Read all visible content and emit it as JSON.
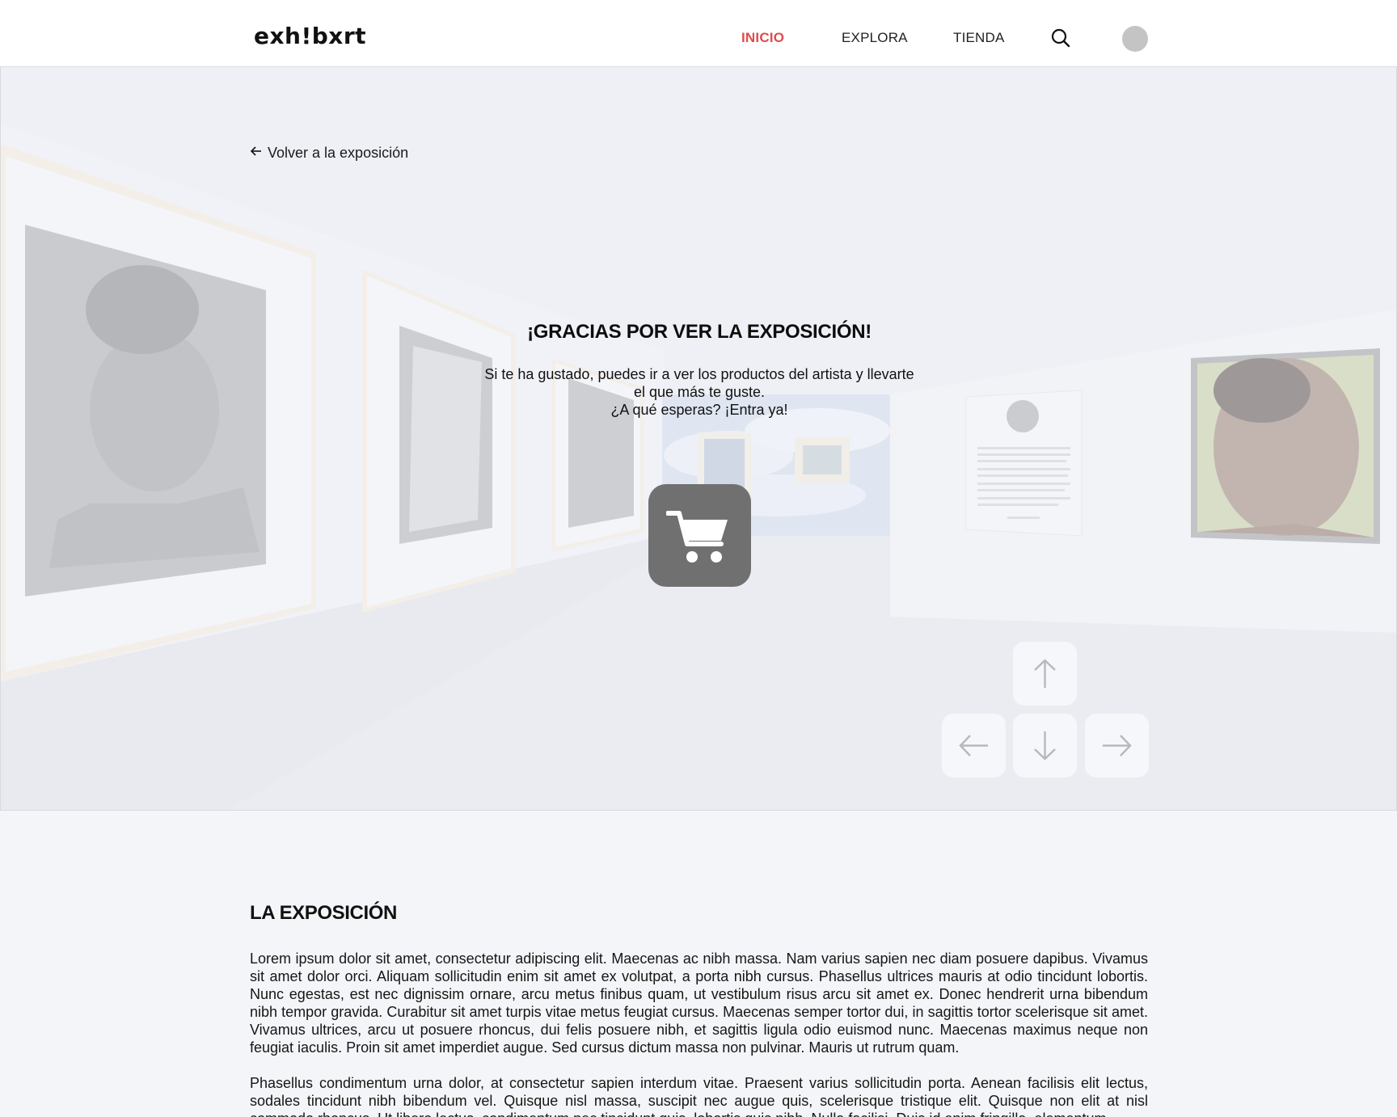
{
  "header": {
    "logo": "exh!bxrt",
    "nav": [
      {
        "label": "INICIO",
        "active": true
      },
      {
        "label": "EXPLORA",
        "active": false
      },
      {
        "label": "TIENDA",
        "active": false
      }
    ],
    "icons": {
      "search": "search-icon",
      "avatar": "avatar"
    }
  },
  "hero": {
    "back_label": "Volver a la exposición",
    "title": "¡GRACIAS POR VER LA EXPOSICIÓN!",
    "message_lines": [
      "Si te ha gustado, puedes ir a ver los productos del artista y llevarte",
      "el que más te guste.",
      "¿A qué esperas? ¡Entra ya!"
    ],
    "cart_icon": "cart-icon",
    "controls": [
      "arrow-up-icon",
      "arrow-left-icon",
      "arrow-down-icon",
      "arrow-right-icon"
    ]
  },
  "content": {
    "section_title": "LA EXPOSICIÓN",
    "paragraphs": [
      "Lorem ipsum dolor sit amet, consectetur adipiscing elit. Maecenas ac nibh massa. Nam varius sapien nec diam posuere dapibus. Vivamus sit amet dolor orci. Aliquam sollicitudin enim sit amet ex volutpat, a porta nibh cursus. Phasellus ultrices mauris at odio tincidunt lobortis. Nunc egestas, est nec dignissim ornare, arcu metus finibus quam, ut vestibulum risus arcu sit amet ex. Donec hendrerit urna bibendum nibh tempor gravida. Curabitur sit amet turpis vitae metus feugiat cursus. Maecenas semper tortor dui, in sagittis tortor scelerisque sit amet. Vivamus ultrices, arcu ut posuere rhoncus, dui felis posuere nibh, et sagittis ligula odio euismod nunc. Maecenas maximus neque non feugiat iaculis. Proin sit amet imperdiet augue. Sed cursus dictum massa non pulvinar. Mauris ut rutrum quam.",
      "Phasellus condimentum urna dolor, at consectetur sapien interdum vitae. Praesent varius sollicitudin porta. Aenean facilisis elit lectus, sodales tincidunt nibh bibendum vel. Quisque nisl massa, suscipit nec augue quis, scelerisque tristique elit. Quisque non elit at nisl commodo rhoncus. Ut libero lectus, condimentum nec tincidunt quis, lobortis quis nibh. Nulla facilisi. Duis id enim fringilla, elementum"
    ]
  },
  "colors": {
    "accent": "#e14b4b",
    "cart_button": "#707070",
    "background": "#f4f5f8"
  }
}
